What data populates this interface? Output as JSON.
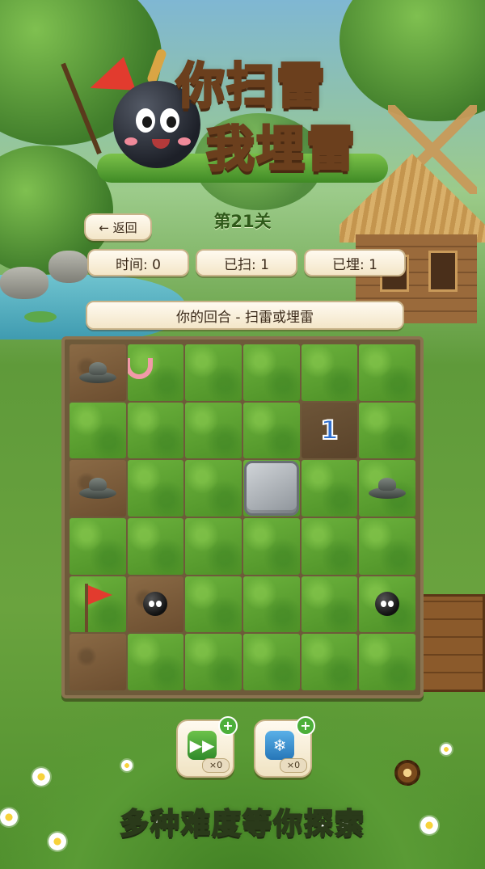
{
  "title": {
    "line1": "你扫雷",
    "line2": "我埋雷"
  },
  "nav": {
    "back_label": "← 返回",
    "level_label": "第21关"
  },
  "stats": {
    "time": "时间: 0",
    "swept": "已扫: 1",
    "buried": "已埋: 1"
  },
  "status": "你的回合 - 扫雷或埋雷",
  "board": {
    "rows": 6,
    "cols": 6,
    "cells": [
      [
        "landmine",
        "worm",
        "grass",
        "grass",
        "grass",
        "grass"
      ],
      [
        "grass",
        "grass",
        "grass",
        "grass",
        "number:1",
        "grass"
      ],
      [
        "landmine",
        "grass",
        "grass",
        "stone",
        "grass",
        "landmine-grass"
      ],
      [
        "grass",
        "grass",
        "grass",
        "grass",
        "grass",
        "grass"
      ],
      [
        "flag",
        "bomb",
        "grass",
        "grass",
        "grass",
        "bomb-grass"
      ],
      [
        "dug",
        "grass",
        "grass",
        "grass",
        "grass",
        "grass"
      ]
    ]
  },
  "tools": [
    {
      "icon": "fast-forward-icon",
      "count": "×0"
    },
    {
      "icon": "snowflake-icon",
      "count": "×0"
    }
  ],
  "slogan": "多种难度等你探索",
  "colors": {
    "accent": "#2f6fcf",
    "flag": "#e23b2e",
    "grass": "#5ea332",
    "panel": "#fffaf0"
  }
}
